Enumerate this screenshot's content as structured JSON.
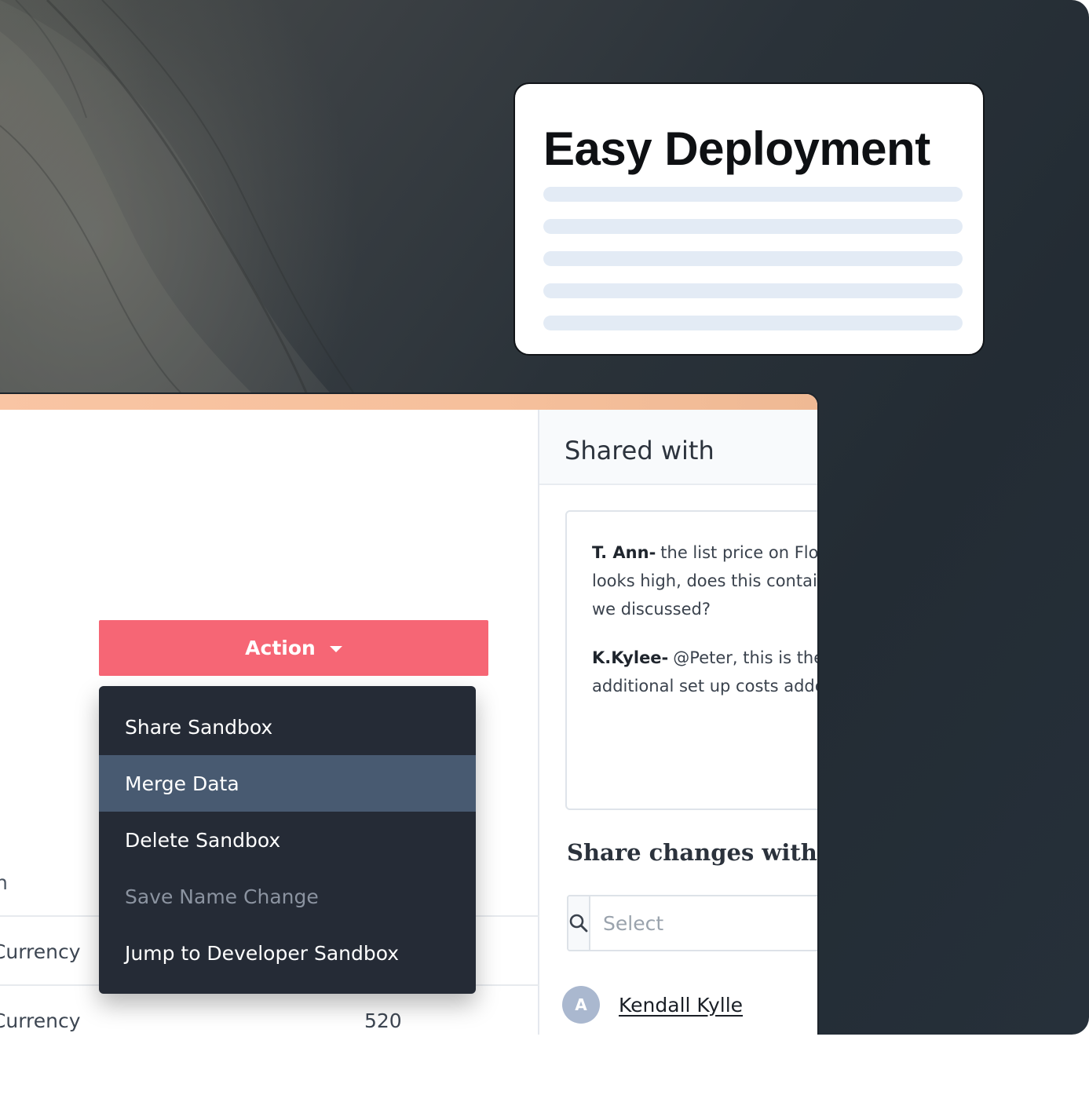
{
  "feature_card": {
    "title": "Easy Deployment"
  },
  "actions": {
    "button_label": "Action",
    "caret_icon": "chevron-down-icon",
    "menu": [
      {
        "label": "Share Sandbox",
        "state": "normal"
      },
      {
        "label": "Merge Data",
        "state": "active"
      },
      {
        "label": "Delete Sandbox",
        "state": "normal"
      },
      {
        "label": "Save Name Change",
        "state": "disabled"
      },
      {
        "label": "Jump to Developer Sandbox",
        "state": "normal"
      }
    ]
  },
  "table": {
    "column_header": "tion",
    "rows": [
      {
        "type": ", Currency",
        "value": ""
      },
      {
        "type": ". Currency",
        "value": "520"
      }
    ]
  },
  "shared_panel": {
    "title": "Shared with",
    "comments": [
      {
        "author": "T. Ann-",
        "lines": [
          "the list price on Flo",
          "looks  high, does this contai",
          "we discussed?"
        ]
      },
      {
        "author": "K.Kylee-",
        "lines": [
          "@Peter, this is the",
          "additional set up costs adde"
        ]
      }
    ],
    "share_heading": "Share changes with",
    "search_icon": "search-icon",
    "select_placeholder": "Select",
    "users": [
      {
        "initial": "A",
        "name": "Kendall Kylle"
      }
    ]
  },
  "colors": {
    "action_button": "#f66675",
    "menu_background": "#252b36",
    "menu_active": "#485a71",
    "window_bar": "#f6c09c"
  }
}
